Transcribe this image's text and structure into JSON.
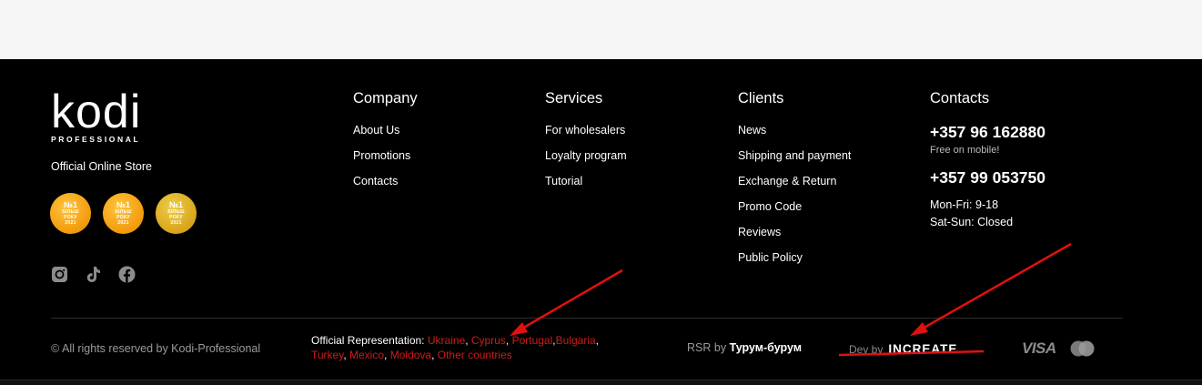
{
  "logo": {
    "main": "kodi",
    "sub": "PROFESSIONAL"
  },
  "store_label": "Official Online Store",
  "badges": [
    {
      "rank": "№1",
      "line1": "БІЛЬШ",
      "line2": "РОКУ",
      "line3": "2021"
    },
    {
      "rank": "№1",
      "line1": "БІЛЬШ",
      "line2": "РОКУ",
      "line3": "2021"
    },
    {
      "rank": "№1",
      "line1": "БІЛЬШ",
      "line2": "РОКУ",
      "line3": "2021"
    }
  ],
  "socials": [
    "instagram-icon",
    "tiktok-icon",
    "facebook-icon"
  ],
  "columns": {
    "company": {
      "title": "Company",
      "items": [
        "About Us",
        "Promotions",
        "Contacts"
      ]
    },
    "services": {
      "title": "Services",
      "items": [
        "For wholesalers",
        "Loyalty program",
        "Tutorial"
      ]
    },
    "clients": {
      "title": "Clients",
      "items": [
        "News",
        "Shipping and payment",
        "Exchange & Return",
        "Promo Code",
        "Reviews",
        "Public Policy"
      ]
    },
    "contacts": {
      "title": "Contacts",
      "phone1": "+357 96 162880",
      "phone1_note": "Free on mobile!",
      "phone2": "+357 99 053750",
      "hours1": "Mon-Fri: 9-18",
      "hours2": "Sat-Sun: Closed"
    }
  },
  "bottom": {
    "copyright": "© All rights reserved by Kodi-Professional",
    "rep_label": "Official Representation:",
    "countries": [
      "Ukraine",
      "Cyprus",
      "Portugal",
      "Bulgaria",
      "Turkey",
      "Mexico",
      "Moldova",
      "Other countries"
    ],
    "rsr_label": "RSR by",
    "rsr_brand": "Турум-бурум",
    "dev_label": "Dev by",
    "dev_brand": "INCREATE",
    "visa": "VISA"
  },
  "colors": {
    "background": "#000000",
    "accent_link": "#d21a1a",
    "badge_orange": "#f29a0c",
    "badge_gold": "#d7a51a",
    "annotation": "#e01010"
  }
}
